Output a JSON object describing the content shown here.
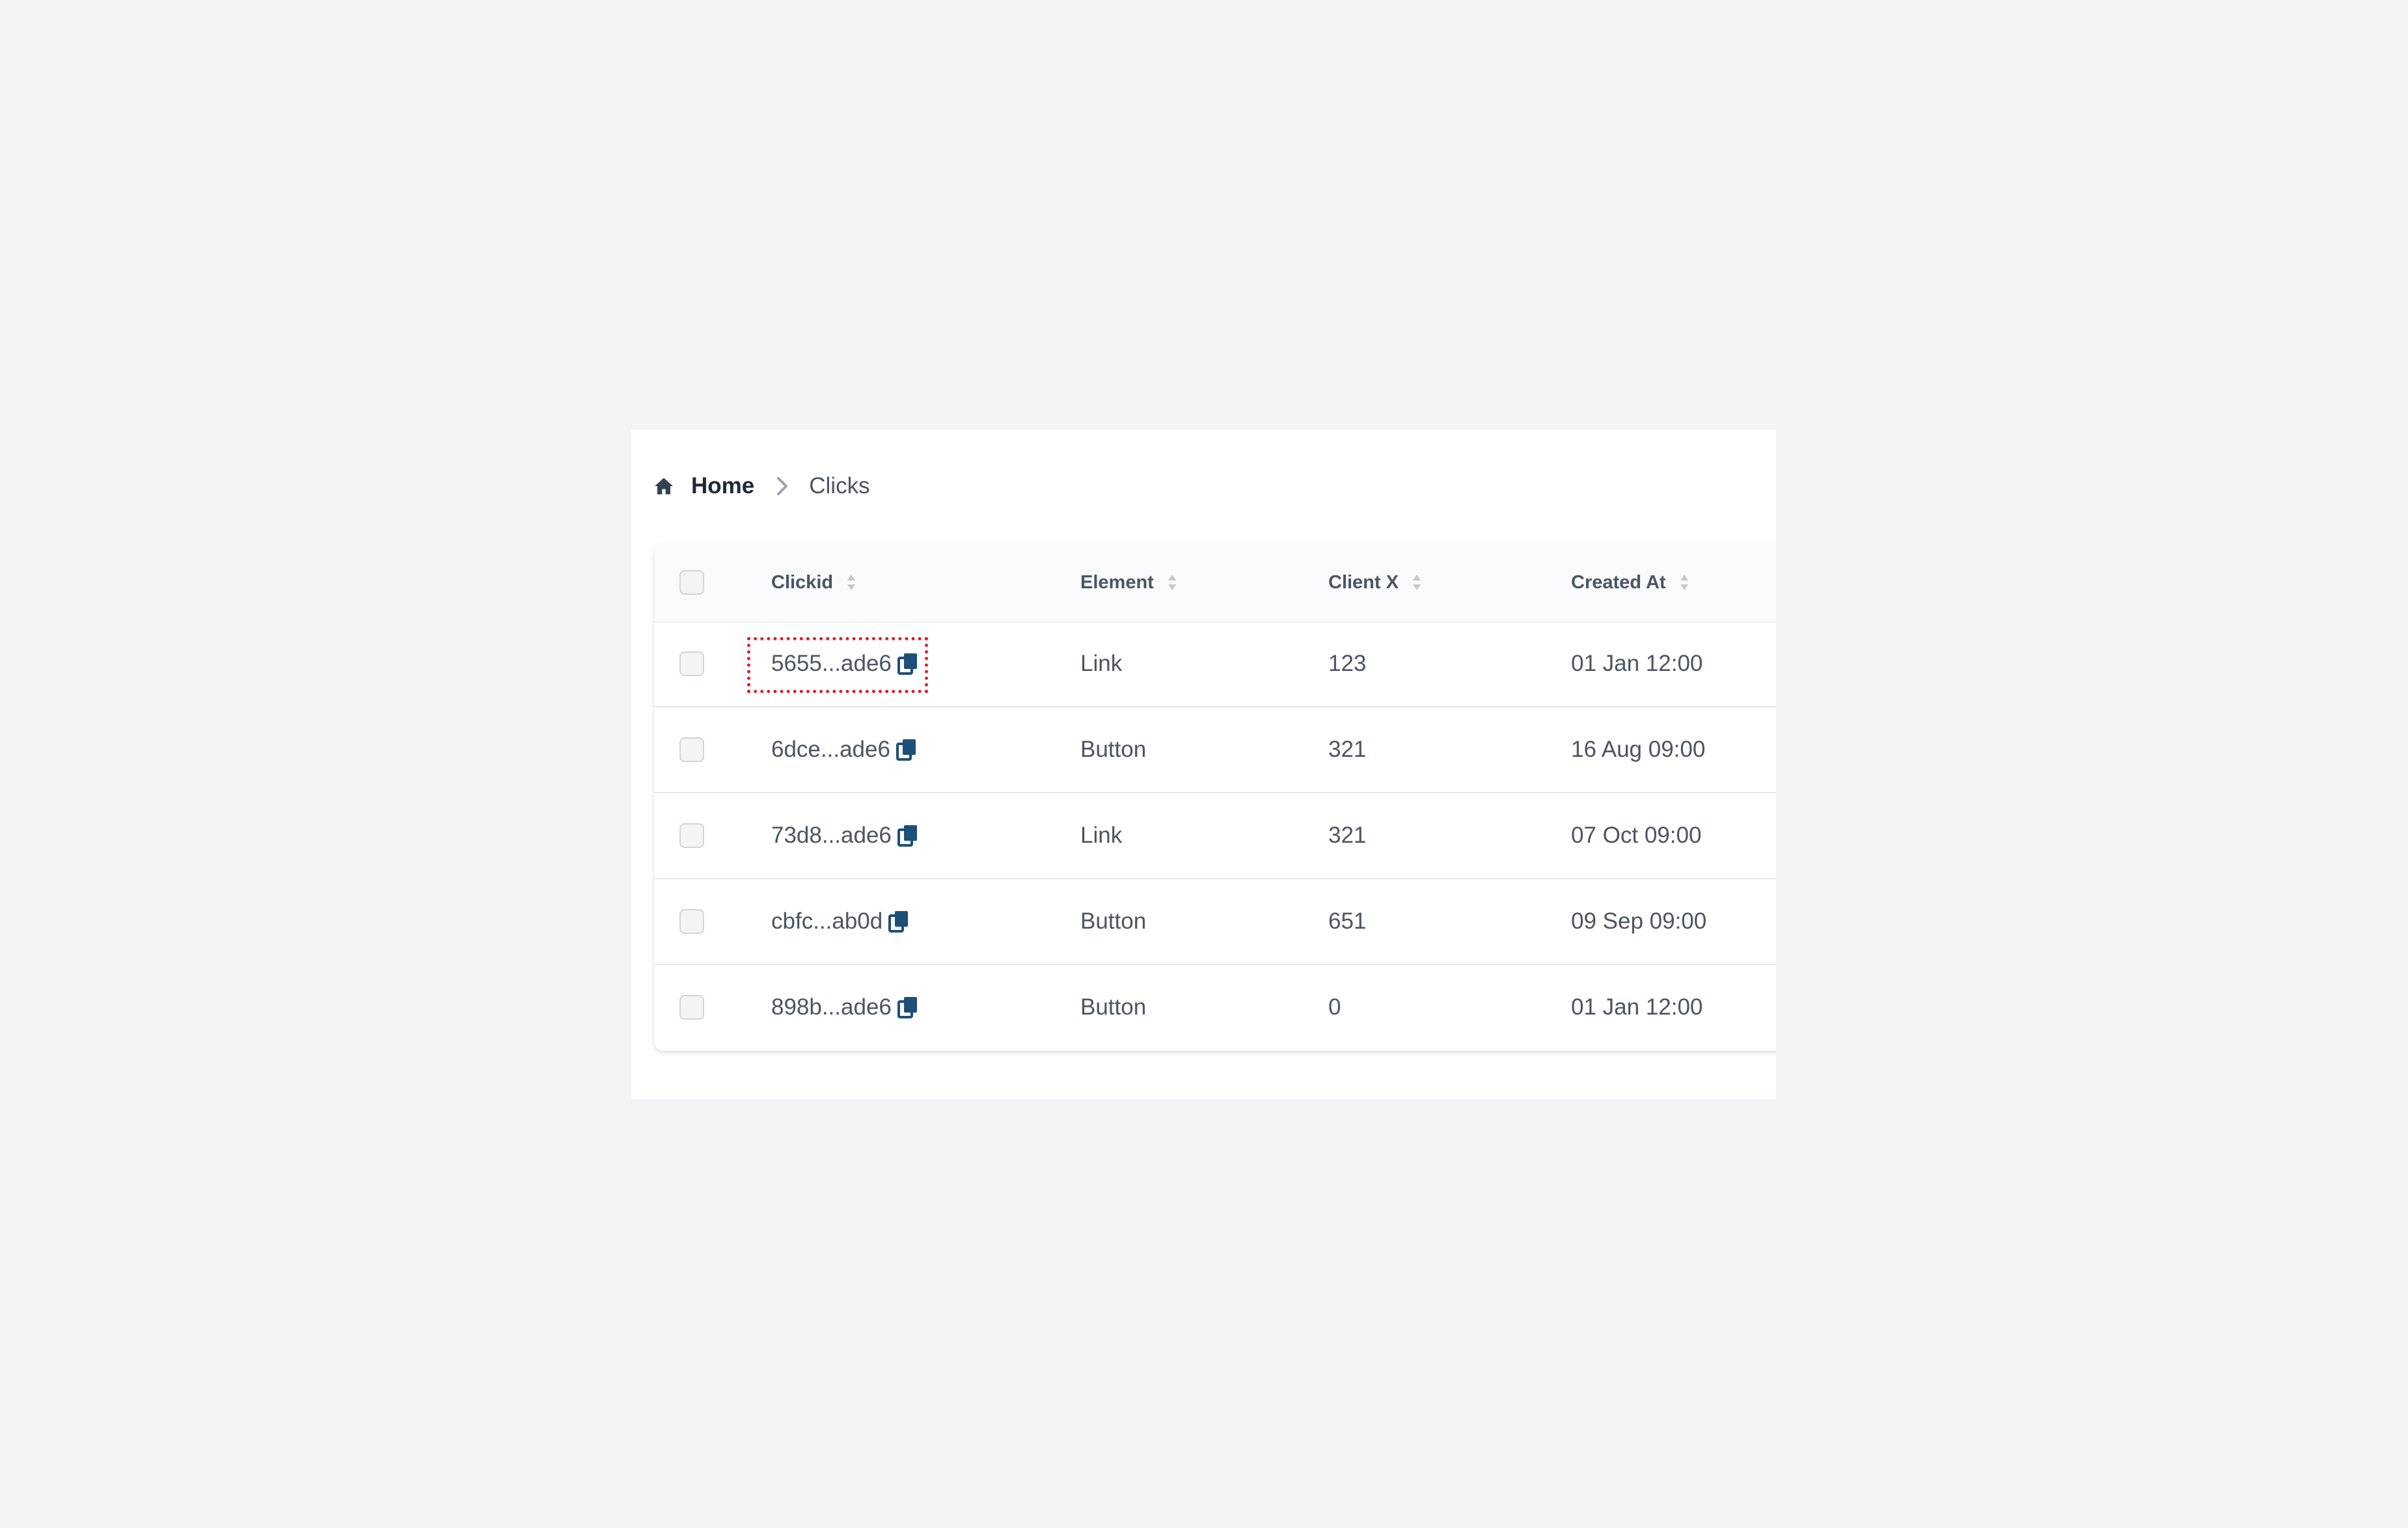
{
  "breadcrumb": {
    "home_icon": "home-icon",
    "home_label": "Home",
    "separator_icon": "chevron-right-icon",
    "current_label": "Clicks"
  },
  "table": {
    "columns": [
      "Clickid",
      "Element",
      "Client X",
      "Created At"
    ],
    "rows": [
      {
        "clickid": "5655...ade6",
        "element": "Link",
        "client_x": "123",
        "created_at": "01 Jan 12:00"
      },
      {
        "clickid": "6dce...ade6",
        "element": "Button",
        "client_x": "321",
        "created_at": "16 Aug 09:00"
      },
      {
        "clickid": "73d8...ade6",
        "element": "Link",
        "client_x": "321",
        "created_at": "07 Oct 09:00"
      },
      {
        "clickid": "cbfc...ab0d",
        "element": "Button",
        "client_x": "651",
        "created_at": "09 Sep 09:00"
      },
      {
        "clickid": "898b...ade6",
        "element": "Button",
        "client_x": "0",
        "created_at": "01 Jan 12:00"
      }
    ]
  },
  "colors": {
    "accent_copy_icon": "#1e4f7a",
    "focus_outline": "#e11d2a",
    "page_background": "#f3f4f6"
  }
}
